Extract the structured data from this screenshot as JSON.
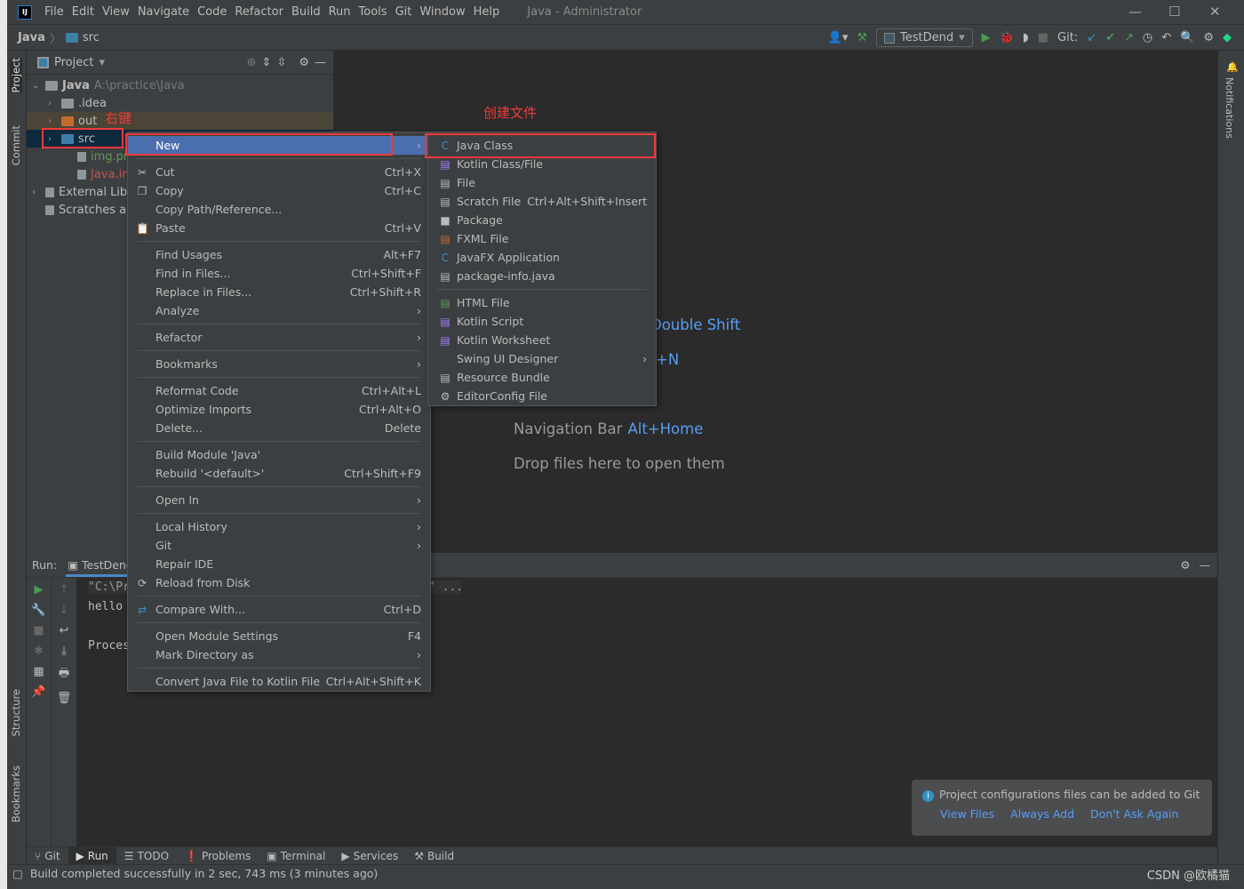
{
  "app": {
    "title": "Java - Administrator",
    "logo": "IJ"
  },
  "menubar": [
    "File",
    "Edit",
    "View",
    "Navigate",
    "Code",
    "Refactor",
    "Build",
    "Run",
    "Tools",
    "Git",
    "Window",
    "Help"
  ],
  "breadcrumb": {
    "project": "Java",
    "folder": "src"
  },
  "toolbar": {
    "run_config": "TestDend",
    "git_label": "Git:"
  },
  "left_tabs": {
    "project": "Project",
    "commit": "Commit",
    "structure": "Structure",
    "bookmarks": "Bookmarks"
  },
  "right_tabs": {
    "notifications": "Notifications"
  },
  "project_panel": {
    "title": "Project",
    "tree": [
      {
        "name": "Java",
        "path": "A:\\practice\\Java",
        "level": 0,
        "expanded": true,
        "icon": "module",
        "bold": true
      },
      {
        "name": ".idea",
        "level": 1,
        "icon": "folder-grey"
      },
      {
        "name": "out",
        "level": 1,
        "icon": "folder-orange",
        "highlight": "excluded"
      },
      {
        "name": "src",
        "level": 1,
        "icon": "folder-blue",
        "selected": true
      },
      {
        "name": "img.png",
        "level": 2,
        "icon": "image",
        "color": "#629755"
      },
      {
        "name": "Java.iml",
        "level": 2,
        "icon": "iml",
        "color": "#c75450"
      },
      {
        "name": "External Libraries",
        "level": 0,
        "icon": "library"
      },
      {
        "name": "Scratches and Consoles",
        "level": 0,
        "icon": "scratch",
        "leaf": true
      }
    ]
  },
  "annotations": {
    "right_click": "右键",
    "create_file": "创建文件"
  },
  "editor_hints": [
    {
      "label": "",
      "key": "Double Shift"
    },
    {
      "label": "",
      "key": "+N"
    },
    {
      "label": "Navigation Bar",
      "key": "Alt+Home"
    },
    {
      "label": "Drop files here to open them",
      "key": ""
    }
  ],
  "context_menu": [
    {
      "label": "New",
      "arrow": true,
      "selected": true
    },
    {
      "sep": true
    },
    {
      "label": "Cut",
      "shortcut": "Ctrl+X",
      "icon": "scissors-icon",
      "glyph": "✂"
    },
    {
      "label": "Copy",
      "shortcut": "Ctrl+C",
      "icon": "copy-icon",
      "glyph": "❐"
    },
    {
      "label": "Copy Path/Reference..."
    },
    {
      "label": "Paste",
      "shortcut": "Ctrl+V",
      "icon": "paste-icon",
      "glyph": "📋"
    },
    {
      "sep": true
    },
    {
      "label": "Find Usages",
      "shortcut": "Alt+F7"
    },
    {
      "label": "Find in Files...",
      "shortcut": "Ctrl+Shift+F"
    },
    {
      "label": "Replace in Files...",
      "shortcut": "Ctrl+Shift+R"
    },
    {
      "label": "Analyze",
      "arrow": true
    },
    {
      "sep": true
    },
    {
      "label": "Refactor",
      "arrow": true
    },
    {
      "sep": true
    },
    {
      "label": "Bookmarks",
      "arrow": true
    },
    {
      "sep": true
    },
    {
      "label": "Reformat Code",
      "shortcut": "Ctrl+Alt+L"
    },
    {
      "label": "Optimize Imports",
      "shortcut": "Ctrl+Alt+O"
    },
    {
      "label": "Delete...",
      "shortcut": "Delete"
    },
    {
      "sep": true
    },
    {
      "label": "Build Module 'Java'"
    },
    {
      "label": "Rebuild '<default>'",
      "shortcut": "Ctrl+Shift+F9"
    },
    {
      "sep": true
    },
    {
      "label": "Open In",
      "arrow": true
    },
    {
      "sep": true
    },
    {
      "label": "Local History",
      "arrow": true
    },
    {
      "label": "Git",
      "arrow": true
    },
    {
      "label": "Repair IDE"
    },
    {
      "label": "Reload from Disk",
      "icon": "reload-icon",
      "glyph": "⟳"
    },
    {
      "sep": true
    },
    {
      "label": "Compare With...",
      "shortcut": "Ctrl+D",
      "icon": "compare-icon",
      "glyph": "⇄",
      "iconColor": "#3592c4"
    },
    {
      "sep": true
    },
    {
      "label": "Open Module Settings",
      "shortcut": "F4"
    },
    {
      "label": "Mark Directory as",
      "arrow": true
    },
    {
      "sep": true
    },
    {
      "label": "Convert Java File to Kotlin File",
      "shortcut": "Ctrl+Alt+Shift+K"
    }
  ],
  "submenu": [
    {
      "label": "Java Class",
      "icon": "java-class-icon",
      "glyph": "C",
      "iconColor": "#3592c4"
    },
    {
      "label": "Kotlin Class/File",
      "icon": "kotlin-file-icon",
      "glyph": "▤",
      "iconColor": "#a97bff"
    },
    {
      "label": "File",
      "icon": "file-icon",
      "glyph": "▤"
    },
    {
      "label": "Scratch File",
      "shortcut": "Ctrl+Alt+Shift+Insert",
      "icon": "scratch-file-icon",
      "glyph": "▤"
    },
    {
      "label": "Package",
      "icon": "package-icon",
      "glyph": "■"
    },
    {
      "label": "FXML File",
      "icon": "fxml-icon",
      "glyph": "▤",
      "iconColor": "#c46a2b"
    },
    {
      "label": "JavaFX Application",
      "icon": "javafx-icon",
      "glyph": "C",
      "iconColor": "#3592c4"
    },
    {
      "label": "package-info.java",
      "icon": "package-info-icon",
      "glyph": "▤"
    },
    {
      "sep": true
    },
    {
      "label": "HTML File",
      "icon": "html-icon",
      "glyph": "▤",
      "iconColor": "#629755"
    },
    {
      "label": "Kotlin Script",
      "icon": "kotlin-script-icon",
      "glyph": "▤",
      "iconColor": "#a97bff"
    },
    {
      "label": "Kotlin Worksheet",
      "icon": "kotlin-worksheet-icon",
      "glyph": "▤",
      "iconColor": "#a97bff"
    },
    {
      "label": "Swing UI Designer",
      "arrow": true
    },
    {
      "label": "Resource Bundle",
      "icon": "resource-bundle-icon",
      "glyph": "▤"
    },
    {
      "label": "EditorConfig File",
      "icon": "editorconfig-icon",
      "glyph": "⚙"
    }
  ],
  "run_panel": {
    "label": "Run:",
    "tab": "TestDend",
    "console": [
      "\"C:\\Pr",
      "hello",
      "",
      "Proces"
    ],
    "ellipsis": "\" ..."
  },
  "bottom_tabs": [
    {
      "label": "Git",
      "glyph": "⑂"
    },
    {
      "label": "Run",
      "glyph": "▶",
      "active": true
    },
    {
      "label": "TODO",
      "glyph": "☰"
    },
    {
      "label": "Problems",
      "glyph": "❗"
    },
    {
      "label": "Terminal",
      "glyph": "▣"
    },
    {
      "label": "Services",
      "glyph": "▶"
    },
    {
      "label": "Build",
      "glyph": "⚒"
    }
  ],
  "status": {
    "text": "Build completed successfully in 2 sec, 743 ms (3 minutes ago)"
  },
  "notification": {
    "message": "Project configurations files can be added to Git",
    "actions": [
      "View Files",
      "Always Add",
      "Don't Ask Again"
    ]
  },
  "watermark": "CSDN @欧橘猫",
  "colors": {
    "accent": "#4b6eaf",
    "link": "#589df6",
    "annotation": "#f03a3a",
    "run_green": "#499c54"
  }
}
